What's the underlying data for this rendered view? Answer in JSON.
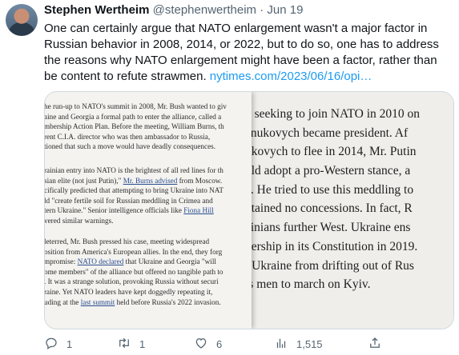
{
  "tweet": {
    "author_name": "Stephen Wertheim",
    "handle": "@stephenwertheim",
    "separator": "·",
    "date": "Jun 19",
    "text_main": "One can certainly argue that NATO enlargement wasn't a major factor in Russian behavior in 2008, 2014, or 2022, but to do so, one has to address the reasons why NATO enlargement might have been a factor, rather than be content to refute strawmen. ",
    "link_text": "nytimes.com/2023/06/16/opi…"
  },
  "clipping_left": {
    "para1": [
      "he run-up to NATO's summit in 2008, Mr. Bush wanted to giv",
      "aine and Georgia a formal path to enter the alliance, called a",
      "mbership Action Plan. Before the meeting, William Burns, th",
      "rent C.I.A. director who was then ambassador to Russia,",
      "tioned that such a move would have deadly consequences."
    ],
    "para2_l1": "rainian entry into NATO is the brightest of all red lines for th",
    "para2_l2_a": "sian elite (not just Putin),\" ",
    "para2_l2_link": "Mr. Burns advised",
    "para2_l2_b": " from Moscow.",
    "para2_l3": "cifically predicted that attempting to bring Ukraine into NAT",
    "para2_l4": "ld \"create fertile soil for Russian meddling in Crimea and",
    "para2_l5_a": "tern Ukraine.\" Senior intelligence officials like ",
    "para2_l5_link": "Fiona Hill",
    "para2_l6": "vered similar warnings.",
    "para3_l1": "leterred, Mr. Bush pressed his case, meeting widespread",
    "para3_l2": "osition from America's European allies. In the end, they forg",
    "para3_l3_a": "mpromise: ",
    "para3_l3_link": "NATO declared",
    "para3_l3_b": " that Ukraine and Georgia \"will",
    "para3_l4": "ome members\" of the alliance but offered no tangible path to",
    "para3_l5": ". It was a strange solution, provoking Russia without securi",
    "para3_l6": "raine. Yet NATO leaders have kept doggedly repeating it,",
    "para3_l7_a": "uding at the ",
    "para3_l7_link": "last summit",
    "para3_l7_b": " held before Russia's 2022 invasion."
  },
  "clipping_right": {
    "lines": [
      "d seeking to join NATO in 2010 on",
      "anukovych became president. Af",
      "ukovych to flee in 2014, Mr. Putin",
      "uld adopt a pro-Western stance, a",
      "a. He tried to use this meddling to",
      "btained no concessions. In fact, R",
      "ainians further West. Ukraine ens",
      "bership in its Constitution in 2019.",
      "t Ukraine from drifting out of Rus",
      "is men to march on Kyiv."
    ]
  },
  "actions": {
    "replies": "1",
    "retweets": "1",
    "likes": "6",
    "views": "1,515"
  },
  "colors": {
    "link": "#1d9bf0",
    "muted": "#536471",
    "text": "#0f1419"
  }
}
